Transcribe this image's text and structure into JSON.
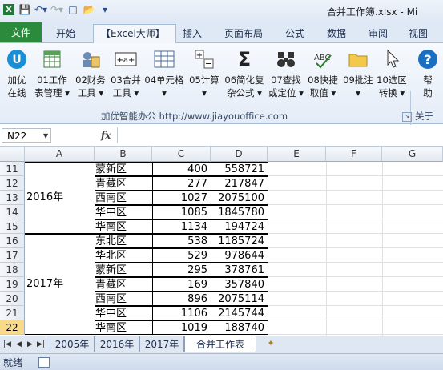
{
  "titlebar": {
    "title": "合并工作簿.xlsx - Mi"
  },
  "tabs": [
    "文件",
    "开始",
    "【Excel大师】",
    "插入",
    "页面布局",
    "公式",
    "数据",
    "审阅",
    "视图"
  ],
  "ribbon": {
    "buttons": [
      {
        "line1": "加优",
        "line2": "在线",
        "icon": "jiayou-logo-icon"
      },
      {
        "line1": "01工作",
        "line2": "表管理 ▾",
        "icon": "sheet-manage-icon"
      },
      {
        "line1": "02财务",
        "line2": "工具 ▾",
        "icon": "finance-tool-icon"
      },
      {
        "line1": "03合并",
        "line2": "工具 ▾",
        "icon": "merge-tool-icon"
      },
      {
        "line1": "04单元格",
        "line2": "▾",
        "icon": "cell-grid-icon"
      },
      {
        "line1": "05计算",
        "line2": "▾",
        "icon": "plus-minus-icon"
      },
      {
        "line1": "06简化复",
        "line2": "杂公式 ▾",
        "icon": "sigma-icon"
      },
      {
        "line1": "07查找",
        "line2": "或定位 ▾",
        "icon": "binoculars-icon"
      },
      {
        "line1": "08快捷",
        "line2": "取值 ▾",
        "icon": "abc-check-icon"
      },
      {
        "line1": "09批注",
        "line2": "▾",
        "icon": "folder-note-icon"
      },
      {
        "line1": "10选区",
        "line2": "转换 ▾",
        "icon": "cursor-icon"
      },
      {
        "line1": "帮",
        "line2": "助",
        "icon": "help-icon"
      }
    ],
    "group_label": "加优智能办公   http://www.jiayouoffice.com",
    "group_label2": "关于"
  },
  "formula_bar": {
    "name_box": "N22",
    "fx": "fx",
    "content": ""
  },
  "columns": [
    "A",
    "B",
    "C",
    "D",
    "E",
    "F",
    "G"
  ],
  "rows": [
    {
      "num": "11",
      "b": "蒙新区",
      "c": "400",
      "d": "558721"
    },
    {
      "num": "12",
      "b": "青藏区",
      "c": "277",
      "d": "217847"
    },
    {
      "num": "13",
      "b": "西南区",
      "c": "1027",
      "d": "2075100"
    },
    {
      "num": "14",
      "b": "华中区",
      "c": "1085",
      "d": "1845780"
    },
    {
      "num": "15",
      "b": "华南区",
      "c": "1134",
      "d": "194724"
    },
    {
      "num": "16",
      "b": "东北区",
      "c": "538",
      "d": "1185724"
    },
    {
      "num": "17",
      "b": "华北区",
      "c": "529",
      "d": "978644"
    },
    {
      "num": "18",
      "b": "蒙新区",
      "c": "295",
      "d": "378761"
    },
    {
      "num": "19",
      "b": "青藏区",
      "c": "169",
      "d": "357840"
    },
    {
      "num": "20",
      "b": "西南区",
      "c": "896",
      "d": "2075114"
    },
    {
      "num": "21",
      "b": "华中区",
      "c": "1106",
      "d": "2145744"
    },
    {
      "num": "22",
      "b": "华南区",
      "c": "1019",
      "d": "188740"
    }
  ],
  "year_labels": {
    "y2016": "2016年",
    "y2017": "2017年"
  },
  "sheet_tabs": [
    "2005年",
    "2016年",
    "2017年",
    "合并工作表"
  ],
  "active_sheet": "合并工作表",
  "status": {
    "text": "就绪"
  },
  "colors": {
    "file_tab": "#2c8a3c",
    "selected_row_header": "#f9d98a"
  }
}
